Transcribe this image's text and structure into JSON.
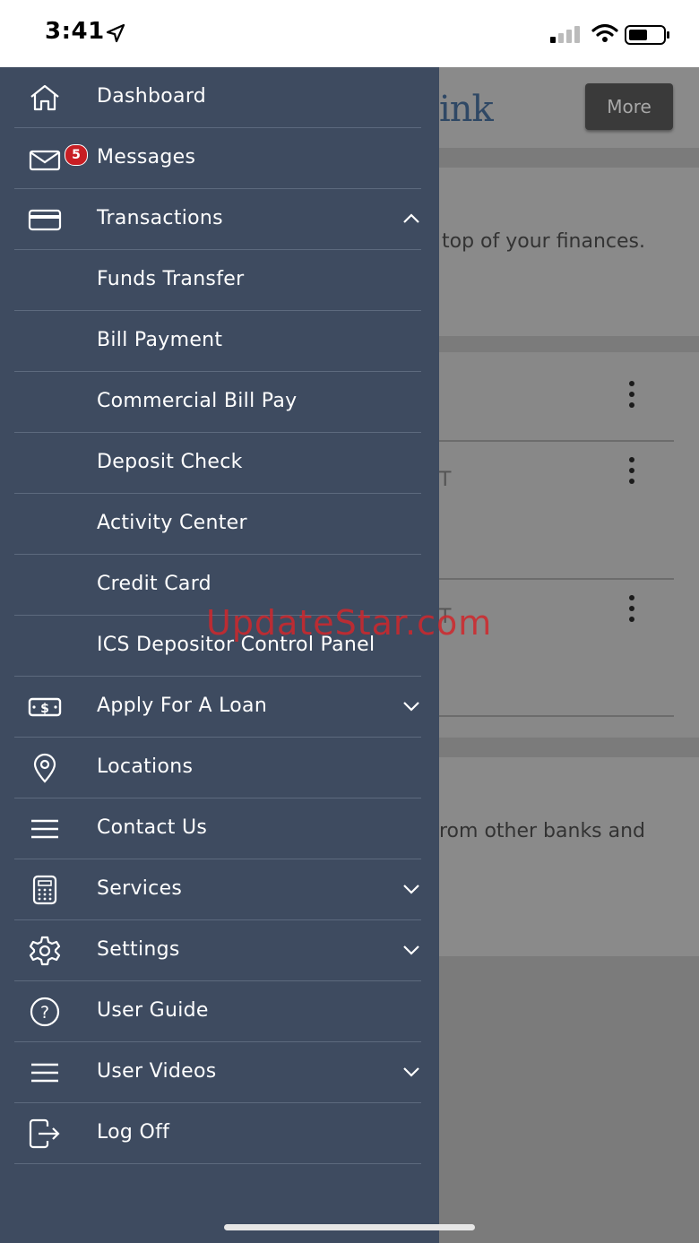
{
  "status_bar": {
    "time": "3:41"
  },
  "background": {
    "logo_fragment": "ink",
    "more_button": "More",
    "intro_text": "top of your finances.",
    "account_rows": [
      "T",
      "T"
    ],
    "promo_text": "rom other banks and"
  },
  "menu": {
    "items": [
      {
        "label": "Dashboard",
        "icon": "home-icon"
      },
      {
        "label": "Messages",
        "icon": "mail-icon",
        "badge": "5"
      },
      {
        "label": "Transactions",
        "icon": "credit-card-icon",
        "expanded": true
      },
      {
        "label": "Funds Transfer"
      },
      {
        "label": "Bill Payment"
      },
      {
        "label": "Commercial Bill Pay"
      },
      {
        "label": "Deposit Check"
      },
      {
        "label": "Activity Center"
      },
      {
        "label": "Credit Card"
      },
      {
        "label": "ICS Depositor Control Panel"
      },
      {
        "label": "Apply For A Loan",
        "icon": "dollar-bill-icon"
      },
      {
        "label": "Locations",
        "icon": "location-pin-icon"
      },
      {
        "label": "Contact Us",
        "icon": "hamburger-icon"
      },
      {
        "label": "Services",
        "icon": "calculator-icon"
      },
      {
        "label": "Settings",
        "icon": "gear-icon"
      },
      {
        "label": "User Guide",
        "icon": "help-circle-icon"
      },
      {
        "label": "User Videos",
        "icon": "hamburger-icon"
      },
      {
        "label": "Log Off",
        "icon": "logout-icon"
      }
    ]
  },
  "watermark": "UpdateStar.com",
  "colors": {
    "drawer": "#3e4b60",
    "badge": "#c81e24",
    "brand_text": "#2f4865"
  }
}
